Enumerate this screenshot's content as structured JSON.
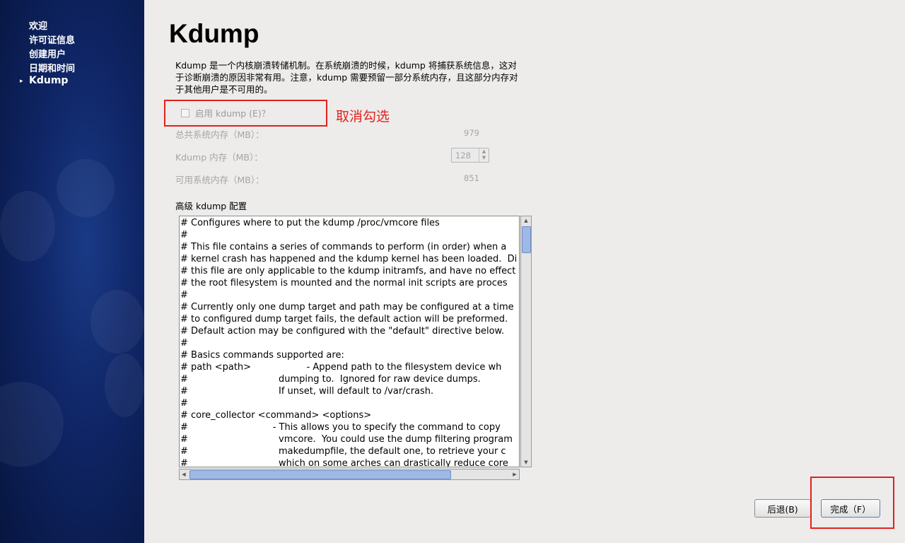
{
  "sidebar": {
    "items": [
      {
        "label": "欢迎"
      },
      {
        "label": "许可证信息"
      },
      {
        "label": "创建用户"
      },
      {
        "label": "日期和时间"
      },
      {
        "label": "Kdump",
        "active": true
      }
    ],
    "active_marker": "▸"
  },
  "main": {
    "title": "Kdump",
    "description": "Kdump 是一个内核崩溃转储机制。在系统崩溃的时候，kdump 将捕获系统信息，这对于诊断崩溃的原因非常有用。注意，kdump 需要预留一部分系统内存，且这部分内存对于其他用户是不可用的。",
    "enable_checkbox": {
      "label": "启用 kdump (E)？",
      "checked": false,
      "enabled": true
    },
    "annotation": "取消勾选",
    "memory": {
      "total": {
        "label": "总共系统内存（MB）：",
        "value": "979"
      },
      "kdump": {
        "label": "Kdump 内存（MB）：",
        "value": "128"
      },
      "available": {
        "label": "可用系统内存（MB）：",
        "value": "851"
      }
    },
    "advanced_label": "高级 kdump 配置",
    "config_text": "# Configures where to put the kdump /proc/vmcore files\n#\n# This file contains a series of commands to perform (in order) when a\n# kernel crash has happened and the kdump kernel has been loaded.  Di\n# this file are only applicable to the kdump initramfs, and have no effect\n# the root filesystem is mounted and the normal init scripts are proces\n#\n# Currently only one dump target and path may be configured at a time\n# to configured dump target fails, the default action will be preformed.\n# Default action may be configured with the \"default\" directive below.\n#\n# Basics commands supported are:\n# path <path>                   - Append path to the filesystem device wh\n#                               dumping to.  Ignored for raw device dumps.\n#                               If unset, will default to /var/crash.\n#\n# core_collector <command> <options>\n#                             - This allows you to specify the command to copy\n#                               vmcore.  You could use the dump filtering program\n#                               makedumpfile, the default one, to retrieve your c\n#                               which on some arches can drastically reduce core\n#                               size. See /usr/sbin/makedumpfile --help for a list o"
  },
  "buttons": {
    "back": "后退(B)",
    "finish": "完成（F）"
  },
  "colors": {
    "highlight": "#e3211c",
    "sidebar": "#0f2565"
  }
}
